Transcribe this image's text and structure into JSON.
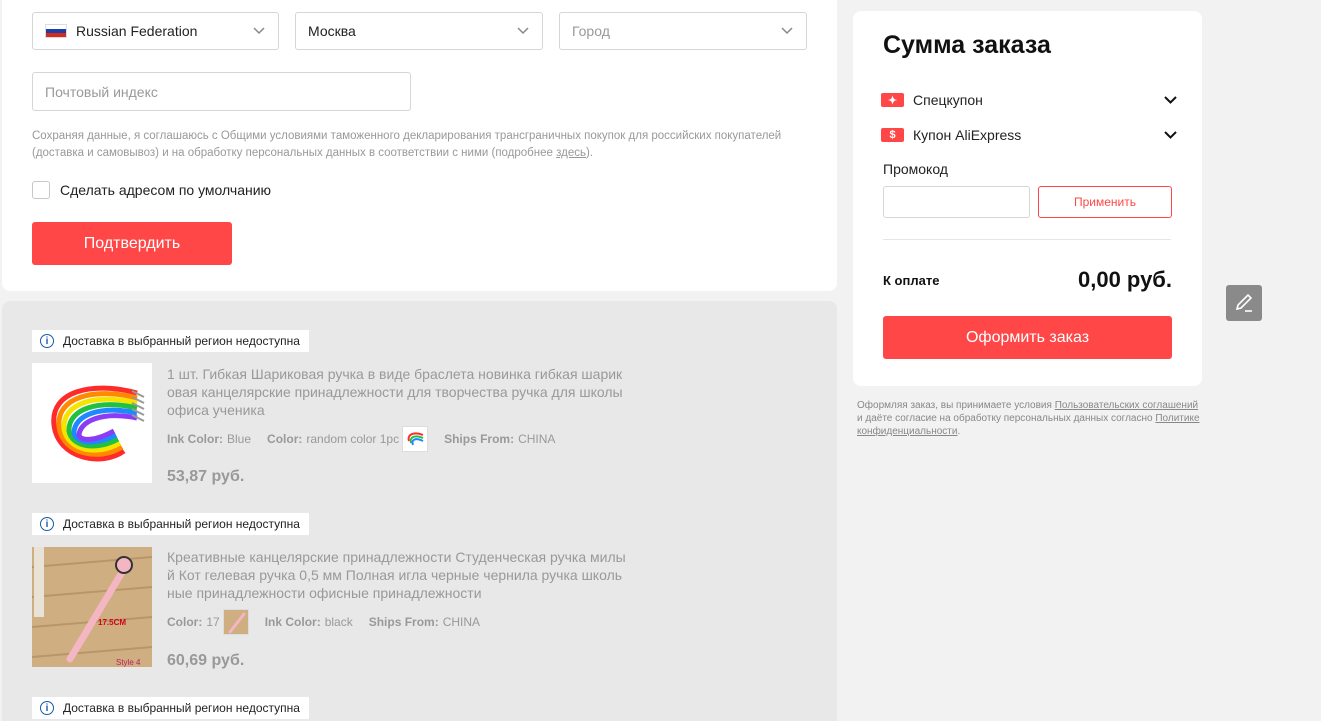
{
  "address_form": {
    "country": "Russian Federation",
    "region": "Москва",
    "city_placeholder": "Город",
    "postal_placeholder": "Почтовый индекс",
    "notice_text": "Сохраняя данные, я соглашаюсь с Общими условиями таможенного декларирования трансграничных покупок для российских покупателей (доставка и самовывоз) и на обработку персональных данных в соответствии с ними (подробнее ",
    "notice_link": "здесь",
    "notice_end": ").",
    "default_checkbox_label": "Сделать адресом по умолчанию",
    "confirm_label": "Подтвердить"
  },
  "items": [
    {
      "notice": "Доставка в выбранный регион недоступна",
      "title": "1 шт. Гибкая Шариковая ручка в виде браслета новинка гибкая шариковая канцелярские принадлежности для творчества ручка для школы офиса ученика",
      "attrs": [
        {
          "key": "Ink Color:",
          "value": "Blue"
        },
        {
          "key": "Color:",
          "value": "random color 1pc"
        },
        {
          "key": "Ships From:",
          "value": "CHINA"
        }
      ],
      "price": "53,87 руб."
    },
    {
      "notice": "Доставка в выбранный регион недоступна",
      "title": "Креативные канцелярские принадлежности Студенческая ручка милый Кот гелевая ручка 0,5 мм Полная игла черные чернила ручка школьные принадлежности офисные принадлежности",
      "attrs": [
        {
          "key": "Color:",
          "value": "17"
        },
        {
          "key": "Ink Color:",
          "value": "black"
        },
        {
          "key": "Ships From:",
          "value": "CHINA"
        }
      ],
      "price": "60,69 руб.",
      "photo_label": "17.5CM",
      "photo_caption": "Style 4"
    },
    {
      "notice": "Доставка в выбранный регион недоступна"
    }
  ],
  "summary": {
    "title": "Сумма заказа",
    "special_coupon": "Спецкупон",
    "ali_coupon": "Купон AliExpress",
    "promo_label": "Промокод",
    "apply_label": "Применить",
    "total_label": "К оплате",
    "total_value": "0,00 руб.",
    "checkout_label": "Оформить заказ"
  },
  "terms": {
    "t1": "Оформляя заказ, вы принимаете условия ",
    "link1": "Пользовательских соглашений",
    "t2": " и даёте согласие на обработку персональных данных согласно ",
    "link2": "Политике конфиденциальности",
    "t3": "."
  },
  "colors": {
    "accent": "#ff4747",
    "info_blue": "#1a5aa8"
  }
}
